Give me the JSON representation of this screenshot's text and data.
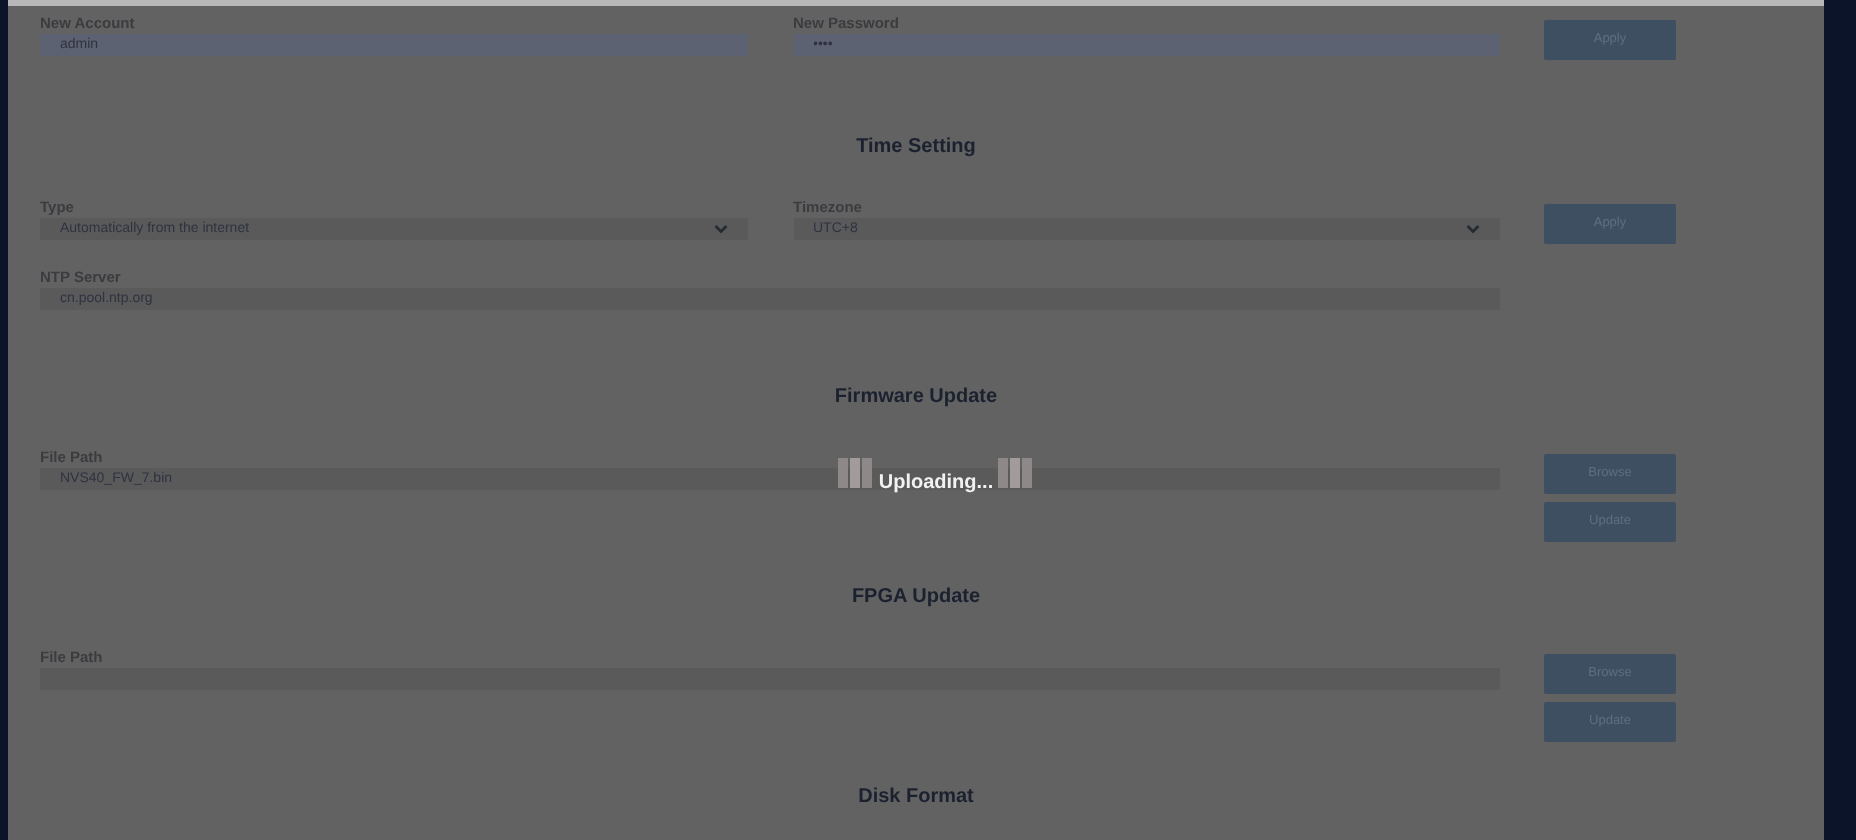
{
  "sections": [
    {
      "rows": [
        {
          "fields": [
            {
              "kind": "text",
              "label": "New Account",
              "value": "admin",
              "autofilled": true
            },
            {
              "kind": "password",
              "label": "New Password",
              "value": "••••",
              "autofilled": true
            }
          ],
          "buttons": [
            "Apply"
          ]
        }
      ]
    },
    {
      "title": "Time Setting",
      "rows": [
        {
          "fields": [
            {
              "kind": "select",
              "label": "Type",
              "value": "Automatically from the internet",
              "autofilled": false
            },
            {
              "kind": "select",
              "label": "Timezone",
              "value": "UTC+8",
              "autofilled": false
            }
          ],
          "buttons": [
            "Apply"
          ]
        },
        {
          "fields": [
            {
              "kind": "text",
              "label": "NTP Server",
              "value": "cn.pool.ntp.org",
              "autofilled": false
            }
          ]
        }
      ]
    },
    {
      "title": "Firmware Update",
      "rows": [
        {
          "fields": [
            {
              "kind": "text",
              "label": "File Path",
              "value": "NVS40_FW_7.bin",
              "autofilled": false
            }
          ],
          "buttons": [
            "Browse",
            "Update"
          ]
        }
      ]
    },
    {
      "title": "FPGA Update",
      "rows": [
        {
          "fields": [
            {
              "kind": "text",
              "label": "File Path",
              "autofilled": false
            }
          ],
          "buttons": [
            "Browse",
            "Update"
          ]
        }
      ]
    },
    {
      "title": "Disk Format"
    }
  ],
  "overlay": {
    "message": "Uploading..."
  }
}
